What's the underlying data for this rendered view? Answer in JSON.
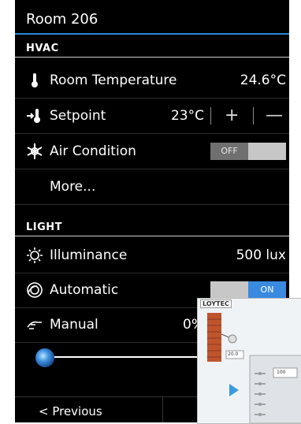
{
  "room": {
    "title": "Room 206"
  },
  "hvac": {
    "section": "HVAC",
    "room_temperature": {
      "label": "Room Temperature",
      "value": "24.6°C"
    },
    "setpoint": {
      "label": "Setpoint",
      "value": "23°C",
      "plus": "+",
      "minus": "—"
    },
    "air_condition": {
      "label": "Air Condition",
      "state": "OFF"
    },
    "more": "More..."
  },
  "light": {
    "section": "LIGHT",
    "illuminance": {
      "label": "Illuminance",
      "value": "500 lux"
    },
    "automatic": {
      "label": "Automatic",
      "state": "ON"
    },
    "manual": {
      "label": "Manual",
      "value": "0%"
    }
  },
  "nav": {
    "previous": "< Previous"
  },
  "overlay": {
    "logo": "LOYTEC",
    "value_a": "20.0",
    "value_b": "100"
  },
  "colors": {
    "accent": "#2a87d6",
    "toggle_on": "#3a8be0",
    "toggle_off_track": "#c7c7c7"
  }
}
